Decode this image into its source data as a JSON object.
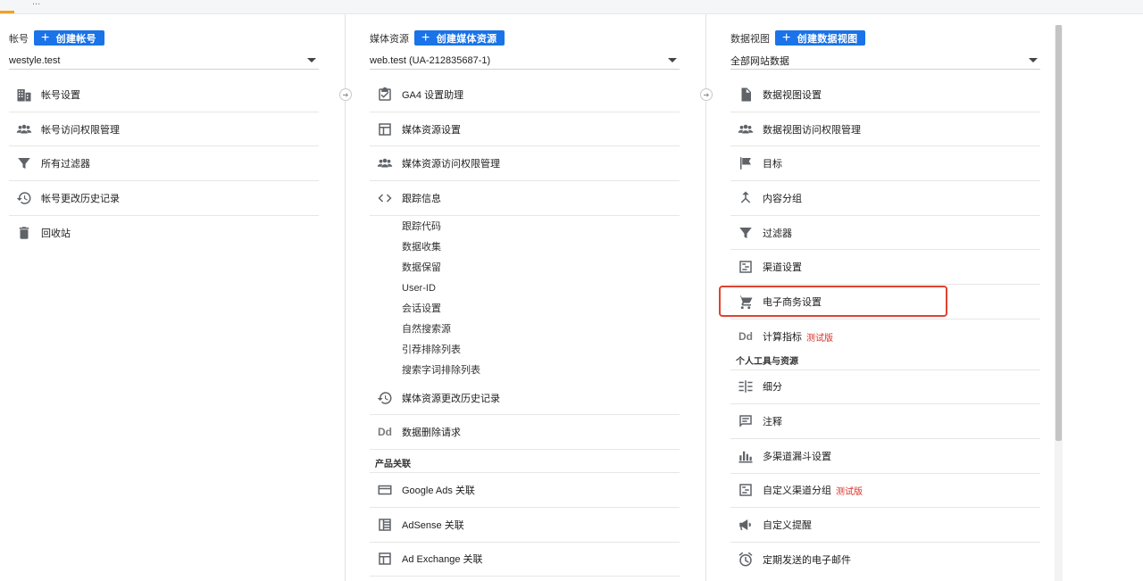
{
  "topbar": {
    "tab_fragment": "..."
  },
  "account": {
    "label": "帐号",
    "create_button": "创建帐号",
    "selected": "westyle.test",
    "items": [
      {
        "label": "帐号设置",
        "icon": "building-icon"
      },
      {
        "label": "帐号访问权限管理",
        "icon": "people-icon"
      },
      {
        "label": "所有过滤器",
        "icon": "filter-icon"
      },
      {
        "label": "帐号更改历史记录",
        "icon": "history-icon"
      },
      {
        "label": "回收站",
        "icon": "trash-icon"
      }
    ]
  },
  "property": {
    "label": "媒体资源",
    "create_button": "创建媒体资源",
    "selected": "web.test (UA-212835687-1)",
    "items": [
      {
        "label": "GA4 设置助理",
        "icon": "checklist-icon"
      },
      {
        "label": "媒体资源设置",
        "icon": "layout-icon"
      },
      {
        "label": "媒体资源访问权限管理",
        "icon": "people-icon"
      },
      {
        "label": "跟踪信息",
        "icon": "code-icon"
      }
    ],
    "tracking_sub": [
      "跟踪代码",
      "数据收集",
      "数据保留",
      "User-ID",
      "会话设置",
      "自然搜索源",
      "引荐排除列表",
      "搜索字词排除列表"
    ],
    "items2": [
      {
        "label": "媒体资源更改历史记录",
        "icon": "history-icon"
      },
      {
        "label": "数据删除请求",
        "icon": "dd-icon",
        "glyph": "Dd"
      }
    ],
    "section_products": "产品关联",
    "products": [
      {
        "label": "Google Ads 关联",
        "icon": "ads-icon"
      },
      {
        "label": "AdSense 关联",
        "icon": "adsense-icon"
      },
      {
        "label": "Ad Exchange 关联",
        "icon": "layout-icon"
      }
    ]
  },
  "view": {
    "label": "数据视图",
    "create_button": "创建数据视图",
    "selected": "全部网站数据",
    "items": [
      {
        "label": "数据视图设置",
        "icon": "document-icon"
      },
      {
        "label": "数据视图访问权限管理",
        "icon": "people-icon"
      },
      {
        "label": "目标",
        "icon": "flag-icon"
      },
      {
        "label": "内容分组",
        "icon": "merge-icon"
      },
      {
        "label": "过滤器",
        "icon": "filter-icon"
      },
      {
        "label": "渠道设置",
        "icon": "channel-icon"
      },
      {
        "label": "电子商务设置",
        "icon": "cart-icon"
      },
      {
        "label": "计算指标",
        "icon": "dd-icon",
        "glyph": "Dd",
        "badge": "测试版"
      }
    ],
    "section_personal": "个人工具与资源",
    "personal": [
      {
        "label": "细分",
        "icon": "segment-icon"
      },
      {
        "label": "注释",
        "icon": "comment-icon"
      },
      {
        "label": "多渠道漏斗设置",
        "icon": "bar-chart-icon"
      },
      {
        "label": "自定义渠道分组",
        "icon": "channel-icon",
        "badge": "测试版"
      },
      {
        "label": "自定义提醒",
        "icon": "megaphone-icon"
      },
      {
        "label": "定期发送的电子邮件",
        "icon": "alarm-icon"
      }
    ]
  },
  "colors": {
    "accent": "#1a73e8",
    "highlight": "#e0432f",
    "beta": "#d93025"
  }
}
